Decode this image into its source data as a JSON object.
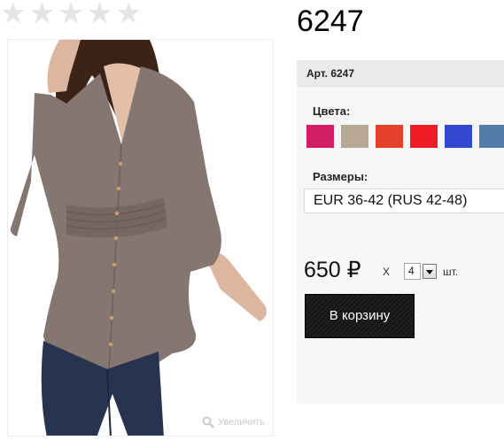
{
  "rating": {
    "stars": [
      "★",
      "★",
      "★",
      "★",
      "★"
    ],
    "filled": 0,
    "star_color": "#e4e4e4"
  },
  "product": {
    "title": "6247",
    "article": "Арт. 6247",
    "colors_label": "Цвета:",
    "colors": [
      {
        "name": "magenta",
        "hex": "#d31e63"
      },
      {
        "name": "beige",
        "hex": "#b8a794"
      },
      {
        "name": "orange-red",
        "hex": "#e5402a"
      },
      {
        "name": "red",
        "hex": "#ee1c25"
      },
      {
        "name": "blue",
        "hex": "#3248d0"
      },
      {
        "name": "steel-blue",
        "hex": "#557bab"
      }
    ],
    "sizes_label": "Размеры:",
    "size_selected": "EUR 36-42 (RUS 42-48)",
    "price": "650 ₽",
    "times_sign": "X",
    "quantity": "4",
    "unit": "шт.",
    "cart_button": "В корзину"
  },
  "image": {
    "zoom_label": "Увеличить",
    "zoom_icon": "magnifier-icon",
    "blouse_color": "#857671",
    "jeans_color": "#26344f"
  }
}
